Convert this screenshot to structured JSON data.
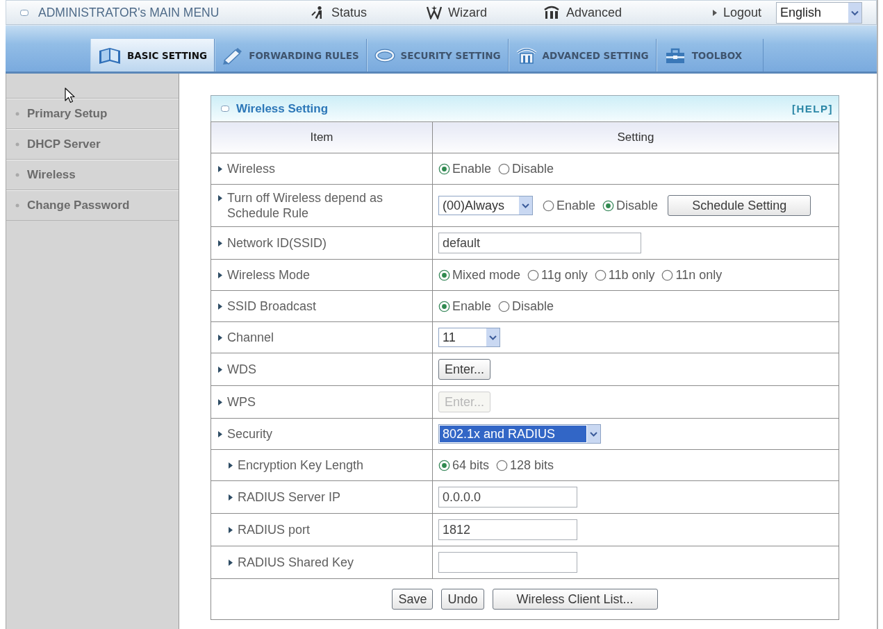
{
  "top_bar": {
    "title": "ADMINISTRATOR's MAIN MENU",
    "links": [
      {
        "label": "Status",
        "kind": "status"
      },
      {
        "label": "Wizard",
        "kind": "wizard"
      },
      {
        "label": "Advanced",
        "kind": "advanced"
      },
      {
        "label": "Logout",
        "kind": "logout"
      }
    ],
    "language": "English"
  },
  "nav_tabs": [
    {
      "label": "BASIC SETTING",
      "kind": "basic",
      "selected": true
    },
    {
      "label": "FORWARDING RULES",
      "kind": "forwarding",
      "selected": false
    },
    {
      "label": "SECURITY SETTING",
      "kind": "security",
      "selected": false
    },
    {
      "label": "ADVANCED SETTING",
      "kind": "advanced",
      "selected": false
    },
    {
      "label": "TOOLBOX",
      "kind": "toolbox",
      "selected": false
    }
  ],
  "sidebar": {
    "items": [
      {
        "label": "Primary Setup"
      },
      {
        "label": "DHCP Server"
      },
      {
        "label": "Wireless"
      },
      {
        "label": "Change Password"
      }
    ]
  },
  "panel": {
    "title": "Wireless Setting",
    "help": "[HELP]",
    "columns": [
      "Item",
      "Setting"
    ],
    "rows": [
      {
        "label": "Wireless",
        "controls": [
          {
            "kind": "radio",
            "options": [
              {
                "label": "Enable",
                "selected": true
              },
              {
                "label": "Disable",
                "selected": false
              }
            ]
          }
        ]
      },
      {
        "label": "Turn off Wireless depend as Schedule Rule",
        "controls": [
          {
            "kind": "select",
            "value": "(00)Always",
            "focused": false
          },
          {
            "kind": "radio",
            "options": [
              {
                "label": "Enable",
                "selected": false
              },
              {
                "label": "Disable",
                "selected": true
              }
            ]
          },
          {
            "kind": "button",
            "label": "Schedule Setting",
            "disabled": false
          }
        ]
      },
      {
        "label": "Network ID(SSID)",
        "controls": [
          {
            "kind": "text",
            "value": "default"
          }
        ]
      },
      {
        "label": "Wireless Mode",
        "controls": [
          {
            "kind": "radio",
            "options": [
              {
                "label": "Mixed mode",
                "selected": true
              },
              {
                "label": "11g only",
                "selected": false
              },
              {
                "label": "11b only",
                "selected": false
              },
              {
                "label": "11n only",
                "selected": false
              }
            ]
          }
        ]
      },
      {
        "label": "SSID Broadcast",
        "controls": [
          {
            "kind": "radio",
            "options": [
              {
                "label": "Enable",
                "selected": true
              },
              {
                "label": "Disable",
                "selected": false
              }
            ]
          }
        ]
      },
      {
        "label": "Channel",
        "controls": [
          {
            "kind": "select",
            "value": "11",
            "focused": false
          }
        ]
      },
      {
        "label": "WDS",
        "controls": [
          {
            "kind": "button",
            "label": "Enter...",
            "disabled": false
          }
        ]
      },
      {
        "label": "WPS",
        "controls": [
          {
            "kind": "button",
            "label": "Enter...",
            "disabled": true
          }
        ]
      },
      {
        "label": "Security",
        "controls": [
          {
            "kind": "select",
            "value": "802.1x and RADIUS",
            "focused": true
          }
        ],
        "children": [
          {
            "label": "Encryption Key Length",
            "controls": [
              {
                "kind": "radio",
                "options": [
                  {
                    "label": "64 bits",
                    "selected": true
                  },
                  {
                    "label": "128 bits",
                    "selected": false
                  }
                ]
              }
            ]
          },
          {
            "label": "RADIUS Server IP",
            "controls": [
              {
                "kind": "text",
                "value": "0.0.0.0"
              }
            ]
          },
          {
            "label": "RADIUS port",
            "controls": [
              {
                "kind": "text",
                "value": "1812"
              }
            ]
          },
          {
            "label": "RADIUS Shared Key",
            "controls": [
              {
                "kind": "text"
              }
            ]
          }
        ]
      }
    ],
    "buttons": [
      {
        "label": "Save",
        "disabled": false
      },
      {
        "label": "Undo",
        "disabled": false
      },
      {
        "label": "Wireless Client List...",
        "disabled": false
      }
    ]
  }
}
